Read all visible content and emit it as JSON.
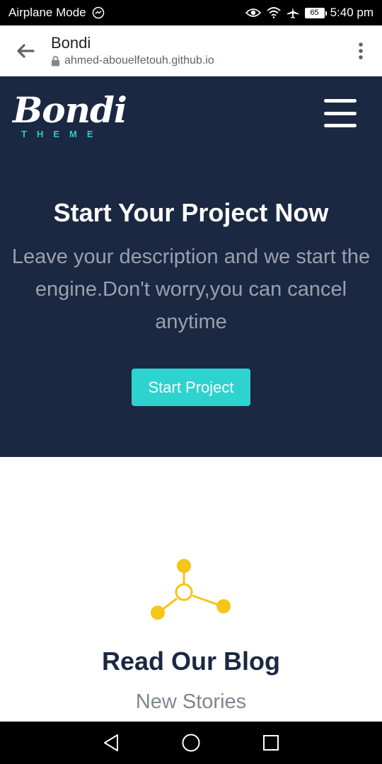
{
  "status_bar": {
    "left_text": "Airplane Mode",
    "battery": "65",
    "time": "5:40 pm"
  },
  "browser": {
    "page_title": "Bondi",
    "url": "ahmed-abouelfetouh.github.io"
  },
  "hero": {
    "logo_text": "Bondi",
    "logo_subtext": "THEME",
    "title": "Start Your Project Now",
    "description": "Leave your description and we start the engine.Don't worry,you can cancel anytime",
    "cta_label": "Start Project"
  },
  "blog": {
    "title": "Read Our Blog",
    "subtitle": "New Stories"
  },
  "colors": {
    "hero_bg": "#1b2842",
    "accent": "#2ed3cf",
    "icon_yellow": "#f5c518"
  }
}
